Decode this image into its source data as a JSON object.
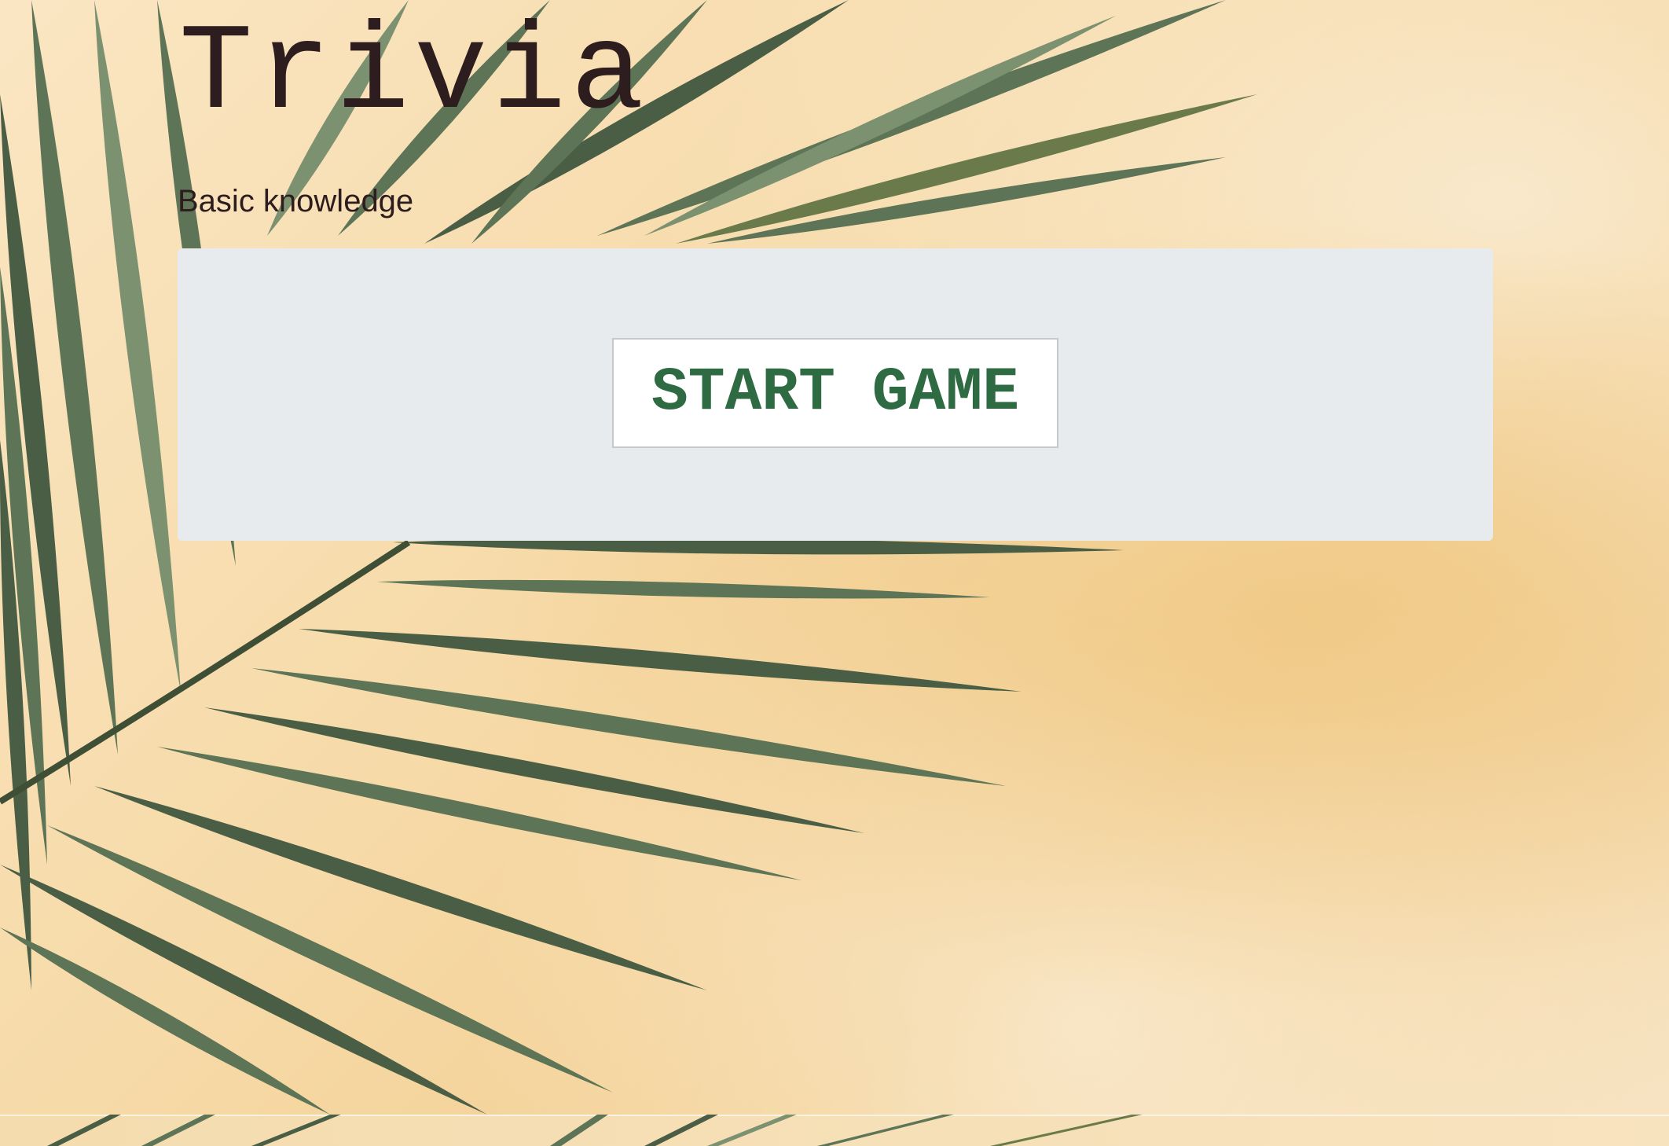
{
  "header": {
    "title": "Trivia",
    "subtitle": "Basic knowledge"
  },
  "main": {
    "start_button_label": "START GAME"
  },
  "background": {
    "description_icon": "palm-leaf-image"
  },
  "colors": {
    "title_text": "#2e1d1f",
    "panel_background": "#e8ebee",
    "button_text": "#2e6b43",
    "page_background": "#f7ddb0"
  }
}
